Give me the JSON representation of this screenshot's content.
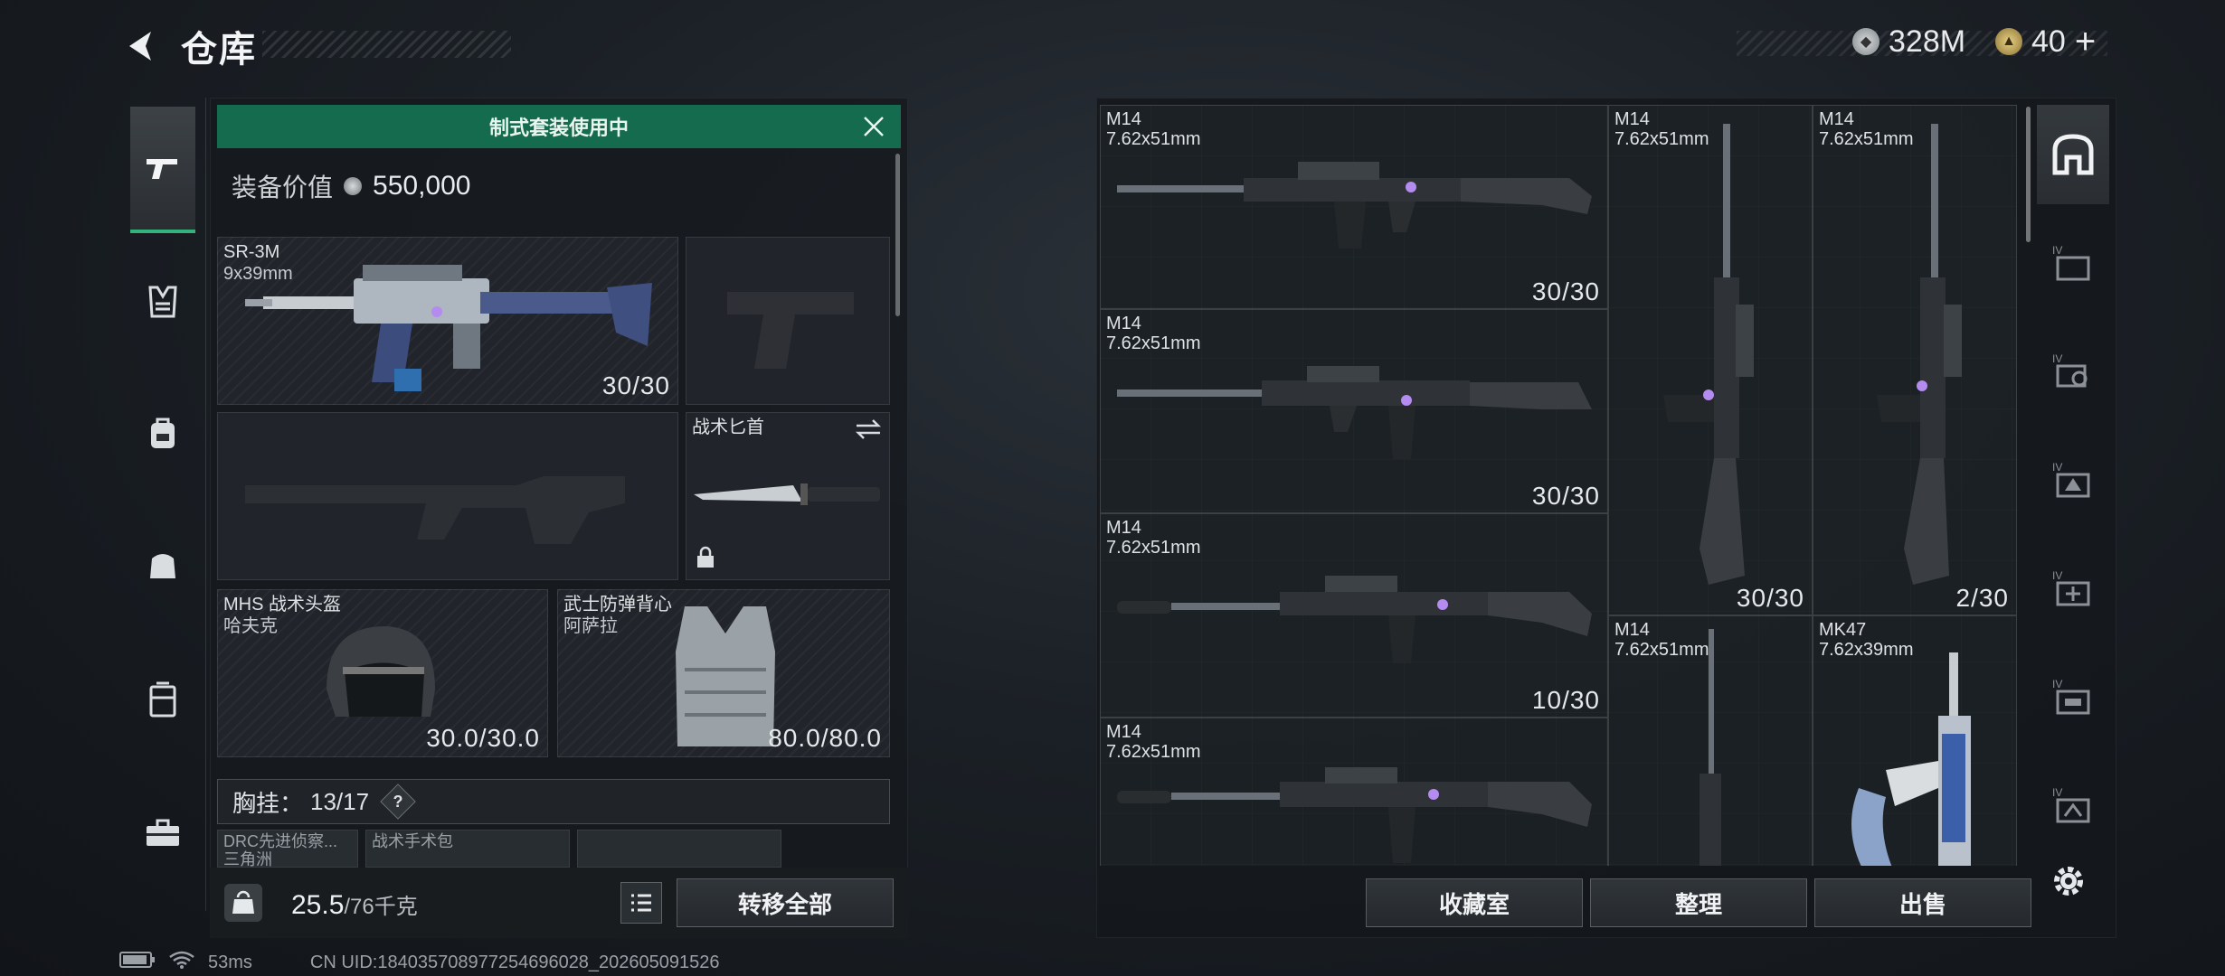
{
  "header": {
    "title": "仓库",
    "currency": [
      {
        "icon": "silver-coin-icon",
        "value": "328M"
      },
      {
        "icon": "gold-coin-icon",
        "value": "40"
      }
    ],
    "add_label": "+"
  },
  "nav": {
    "items": [
      {
        "name": "weapons",
        "icon": "pistol-icon"
      },
      {
        "name": "chest-rig",
        "icon": "vest-icon"
      },
      {
        "name": "backpack",
        "icon": "backpack-icon"
      },
      {
        "name": "bag",
        "icon": "bag-icon"
      },
      {
        "name": "container",
        "icon": "case-icon"
      },
      {
        "name": "toolbox",
        "icon": "toolbox-icon"
      }
    ]
  },
  "loadout": {
    "banner": "制式套装使用中",
    "value_label": "装备价值",
    "value": "550,000",
    "primary": {
      "name": "SR-3M",
      "caliber": "9x39mm",
      "count": "30/30"
    },
    "knife": {
      "name": "战术匕首"
    },
    "helmet": {
      "name": "MHS 战术头盔",
      "sub": "哈夫克",
      "count": "30.0/30.0"
    },
    "armor": {
      "name": "武士防弹背心",
      "sub": "阿萨拉",
      "count": "80.0/80.0"
    },
    "chest": {
      "label": "胸挂：",
      "value": "13/17",
      "help": "?"
    },
    "mini_slots": [
      {
        "name": "DRC先进侦察...",
        "sub": "三角洲"
      },
      {
        "name": "战术手术包",
        "sub": ""
      },
      {
        "name": "",
        "sub": ""
      }
    ],
    "weight": {
      "value": "25.5",
      "max": "/76千克"
    },
    "transfer_all": "转移全部"
  },
  "stash": {
    "items": [
      {
        "name": "M14",
        "caliber": "7.62x51mm",
        "count": "30/30"
      },
      {
        "name": "M14",
        "caliber": "7.62x51mm",
        "count": "30/30"
      },
      {
        "name": "M14",
        "caliber": "7.62x51mm",
        "count": "10/30"
      },
      {
        "name": "M14",
        "caliber": "7.62x51mm",
        "count": ""
      },
      {
        "name": "M14",
        "caliber": "7.62x51mm",
        "count": "30/30"
      },
      {
        "name": "M14",
        "caliber": "7.62x51mm",
        "count": "2/30"
      },
      {
        "name": "M14",
        "caliber": "7.62x51mm",
        "count": ""
      },
      {
        "name": "MK47",
        "caliber": "7.62x39mm",
        "count": ""
      }
    ],
    "buttons": {
      "collection": "收藏室",
      "sort": "整理",
      "sell": "出售"
    }
  },
  "status_bar": {
    "ping": "53ms",
    "uid": "CN UID:1840357089772546960​28_202605091526"
  },
  "colors": {
    "accent_green": "#146b4d",
    "active_underline": "#34b27c"
  }
}
